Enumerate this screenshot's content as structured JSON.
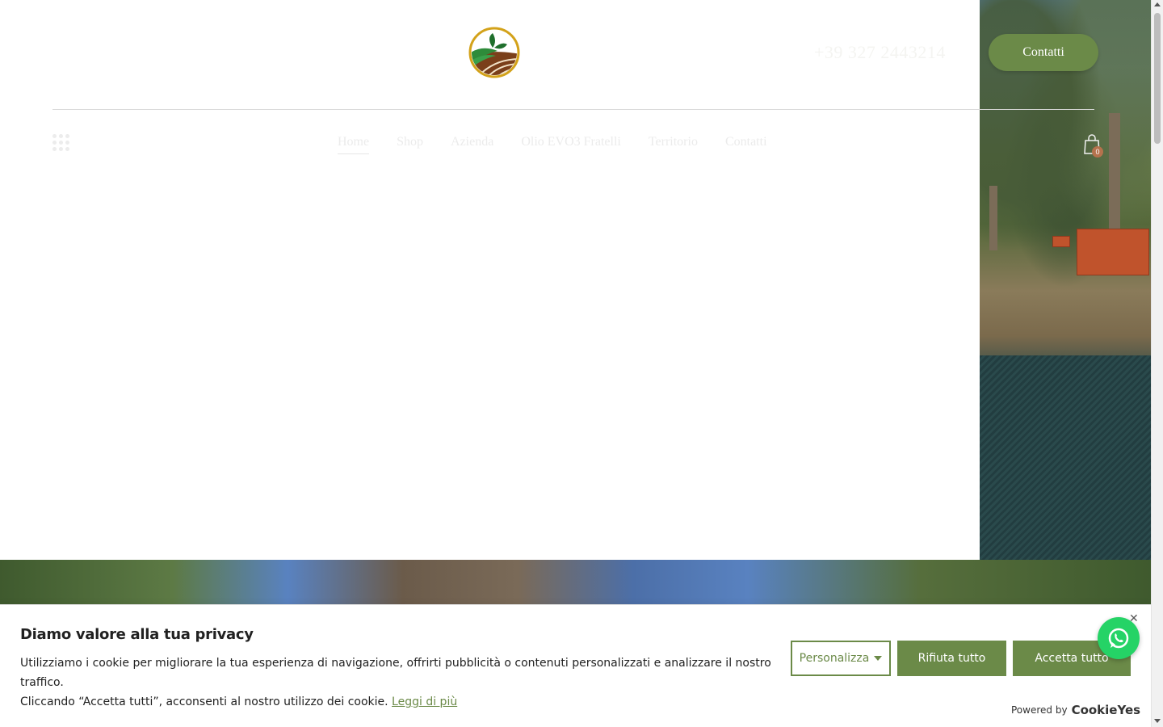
{
  "header": {
    "logo_name": "farm-leaf-logo",
    "phone": "+39 327 2443214",
    "contact_button": "Contatti"
  },
  "nav": {
    "items": [
      {
        "label": "Home",
        "active": true
      },
      {
        "label": "Shop"
      },
      {
        "label": "Azienda"
      },
      {
        "label": "Olio EVO3 Fratelli"
      },
      {
        "label": "Territorio"
      },
      {
        "label": "Contatti"
      }
    ],
    "cart_count": "0"
  },
  "cookie": {
    "title": "Diamo valore alla tua privacy",
    "text_line1": "Utilizziamo i cookie per migliorare la tua esperienza di navigazione, offrirti pubblicità o contenuti personalizzati e analizzare il nostro traffico.",
    "text_line2": "Cliccando “Accetta tutti”, acconsenti al nostro utilizzo dei cookie.",
    "link": "Leggi di più",
    "customize": "Personalizza",
    "reject": "Rifiuta tutto",
    "accept": "Accetta tutto",
    "powered_by": "Powered by",
    "brand": "CookieYes"
  },
  "colors": {
    "accent": "#6b8a48",
    "cart_badge": "#b5724d",
    "whatsapp": "#25d366"
  }
}
